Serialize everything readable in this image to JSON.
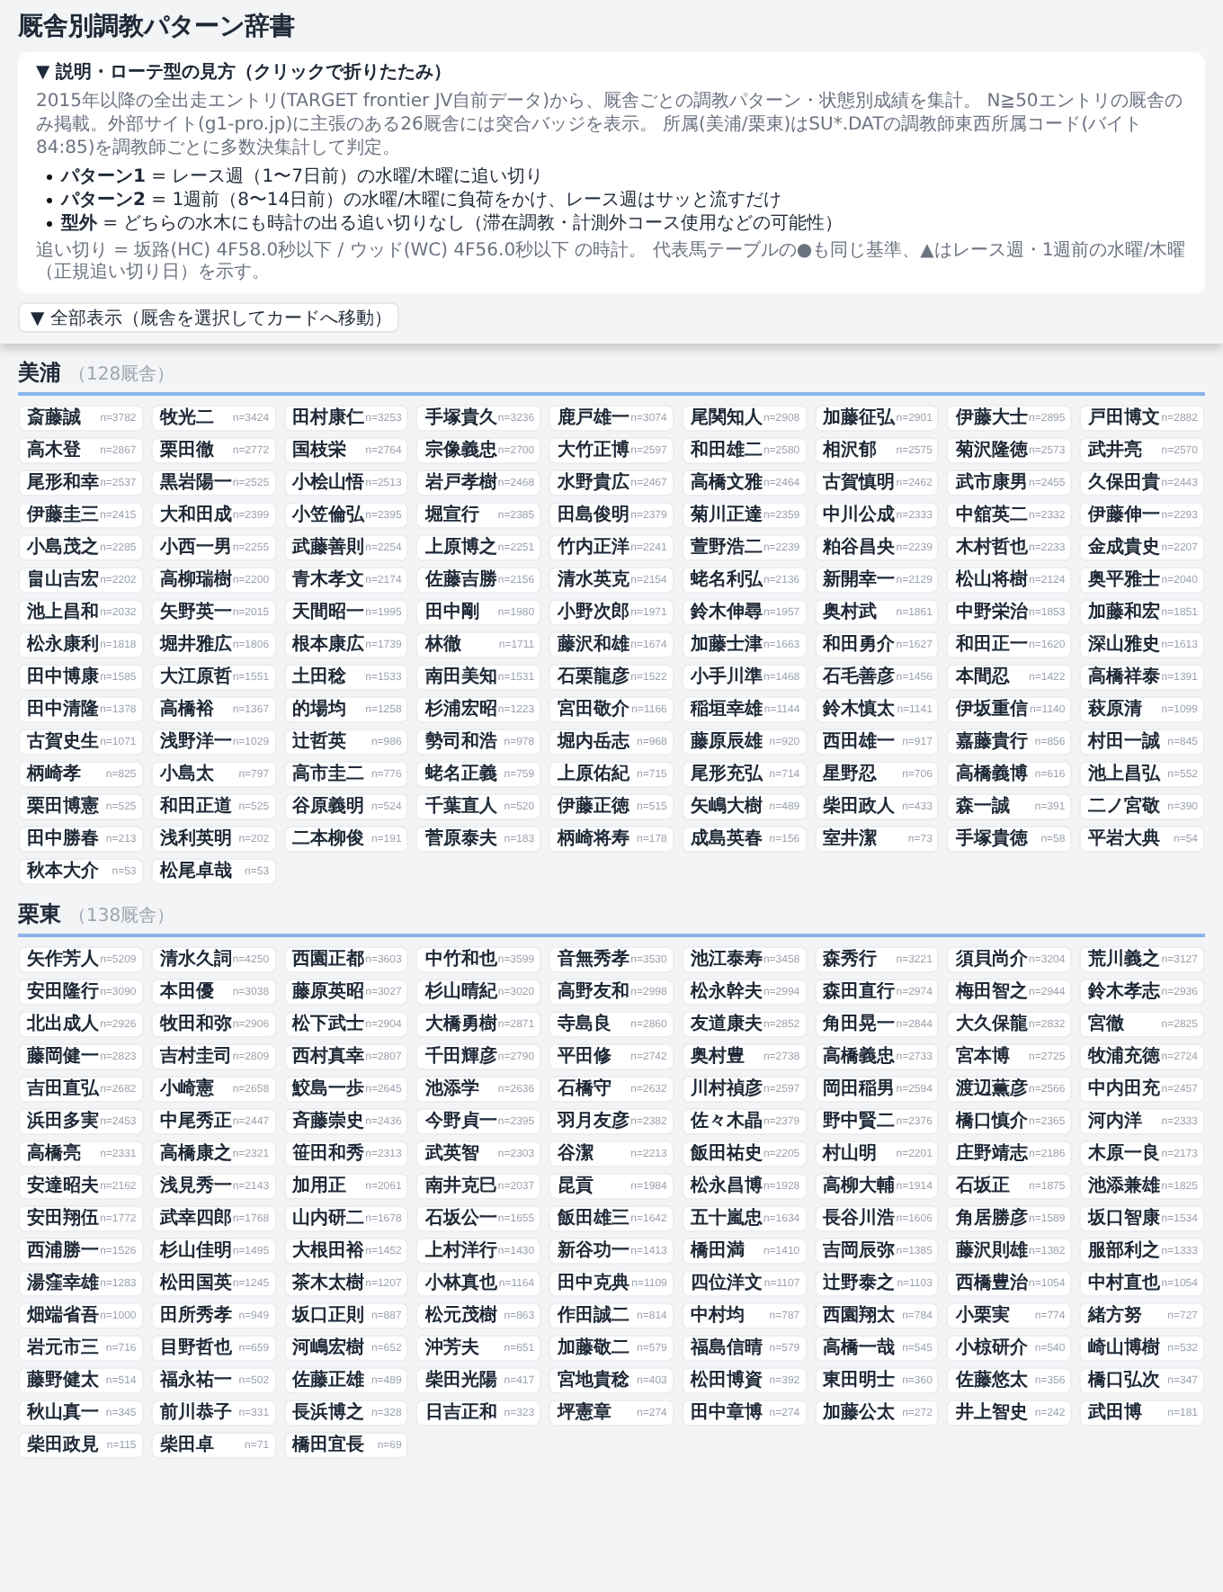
{
  "title": "厩舎別調教パターン辞書",
  "explanation": {
    "summary": "▼ 説明・ローテ型の見方（クリックで折りたたみ）",
    "paragraph": "2015年以降の全出走エントリ(TARGET frontier JV自前データ)から、厩舎ごとの調教パターン・状態別成績を集計。 N≧50エントリの厩舎のみ掲載。外部サイト(g1-pro.jp)に主張のある26厩舎には突合バッジを表示。 所属(美浦/栗東)はSU*.DATの調教師東西所属コード(バイト84:85)を調教師ごとに多数決集計して判定。",
    "bullets": [
      "**パターン1** = レース週（1〜7日前）の水曜/木曜に追い切り",
      "**パターン2** = 1週前（8〜14日前）の水曜/木曜に負荷をかけ、レース週はサッと流すだけ",
      "**型外** = どちらの水木にも時計の出る追い切りなし（滞在調教・計測外コース使用などの可能性）"
    ],
    "note": "追い切り = 坂路(HC) 4F58.0秒以下 / ウッド(WC) 4F56.0秒以下 の時計。 代表馬テーブルの●も同じ基準、▲はレース週・1週前の水曜/木曜（正規追い切り日）を示す。"
  },
  "jump_select": {
    "value": "▼ 全部表示（厩舎を選択してカードへ移動）"
  },
  "sections": [
    {
      "name": "美浦",
      "count": "（128厩舎）",
      "stables": [
        {
          "name": "斎藤誠",
          "n": "n=3782"
        },
        {
          "name": "牧光二",
          "n": "n=3424"
        },
        {
          "name": "田村康仁",
          "n": "n=3253"
        },
        {
          "name": "手塚貴久",
          "n": "n=3236"
        },
        {
          "name": "鹿戸雄一",
          "n": "n=3074"
        },
        {
          "name": "尾関知人",
          "n": "n=2908"
        },
        {
          "name": "加藤征弘",
          "n": "n=2901"
        },
        {
          "name": "伊藤大士",
          "n": "n=2895"
        },
        {
          "name": "戸田博文",
          "n": "n=2882"
        },
        {
          "name": "高木登",
          "n": "n=2867"
        },
        {
          "name": "栗田徹",
          "n": "n=2772"
        },
        {
          "name": "国枝栄",
          "n": "n=2764"
        },
        {
          "name": "宗像義忠",
          "n": "n=2700"
        },
        {
          "name": "大竹正博",
          "n": "n=2597"
        },
        {
          "name": "和田雄二",
          "n": "n=2580"
        },
        {
          "name": "相沢郁",
          "n": "n=2575"
        },
        {
          "name": "菊沢隆徳",
          "n": "n=2573"
        },
        {
          "name": "武井亮",
          "n": "n=2570"
        },
        {
          "name": "尾形和幸",
          "n": "n=2537"
        },
        {
          "name": "黒岩陽一",
          "n": "n=2525"
        },
        {
          "name": "小桧山悟",
          "n": "n=2513"
        },
        {
          "name": "岩戸孝樹",
          "n": "n=2468"
        },
        {
          "name": "水野貴広",
          "n": "n=2467"
        },
        {
          "name": "高橋文雅",
          "n": "n=2464"
        },
        {
          "name": "古賀慎明",
          "n": "n=2462"
        },
        {
          "name": "武市康男",
          "n": "n=2455"
        },
        {
          "name": "久保田貴",
          "n": "n=2443"
        },
        {
          "name": "伊藤圭三",
          "n": "n=2415"
        },
        {
          "name": "大和田成",
          "n": "n=2399"
        },
        {
          "name": "小笠倫弘",
          "n": "n=2395"
        },
        {
          "name": "堀宣行",
          "n": "n=2385"
        },
        {
          "name": "田島俊明",
          "n": "n=2379"
        },
        {
          "name": "菊川正達",
          "n": "n=2359"
        },
        {
          "name": "中川公成",
          "n": "n=2333"
        },
        {
          "name": "中舘英二",
          "n": "n=2332"
        },
        {
          "name": "伊藤伸一",
          "n": "n=2293"
        },
        {
          "name": "小島茂之",
          "n": "n=2285"
        },
        {
          "name": "小西一男",
          "n": "n=2255"
        },
        {
          "name": "武藤善則",
          "n": "n=2254"
        },
        {
          "name": "上原博之",
          "n": "n=2251"
        },
        {
          "name": "竹内正洋",
          "n": "n=2241"
        },
        {
          "name": "萱野浩二",
          "n": "n=2239"
        },
        {
          "name": "粕谷昌央",
          "n": "n=2239"
        },
        {
          "name": "木村哲也",
          "n": "n=2233"
        },
        {
          "name": "金成貴史",
          "n": "n=2207"
        },
        {
          "name": "畠山吉宏",
          "n": "n=2202"
        },
        {
          "name": "高柳瑞樹",
          "n": "n=2200"
        },
        {
          "name": "青木孝文",
          "n": "n=2174"
        },
        {
          "name": "佐藤吉勝",
          "n": "n=2156"
        },
        {
          "name": "清水英克",
          "n": "n=2154"
        },
        {
          "name": "蛯名利弘",
          "n": "n=2136"
        },
        {
          "name": "新開幸一",
          "n": "n=2129"
        },
        {
          "name": "松山将樹",
          "n": "n=2124"
        },
        {
          "name": "奥平雅士",
          "n": "n=2040"
        },
        {
          "name": "池上昌和",
          "n": "n=2032"
        },
        {
          "name": "矢野英一",
          "n": "n=2015"
        },
        {
          "name": "天間昭一",
          "n": "n=1995"
        },
        {
          "name": "田中剛",
          "n": "n=1980"
        },
        {
          "name": "小野次郎",
          "n": "n=1971"
        },
        {
          "name": "鈴木伸尋",
          "n": "n=1957"
        },
        {
          "name": "奥村武",
          "n": "n=1861"
        },
        {
          "name": "中野栄治",
          "n": "n=1853"
        },
        {
          "name": "加藤和宏",
          "n": "n=1851"
        },
        {
          "name": "松永康利",
          "n": "n=1818"
        },
        {
          "name": "堀井雅広",
          "n": "n=1806"
        },
        {
          "name": "根本康広",
          "n": "n=1739"
        },
        {
          "name": "林徹",
          "n": "n=1711"
        },
        {
          "name": "藤沢和雄",
          "n": "n=1674"
        },
        {
          "name": "加藤士津",
          "n": "n=1663"
        },
        {
          "name": "和田勇介",
          "n": "n=1627"
        },
        {
          "name": "和田正一",
          "n": "n=1620"
        },
        {
          "name": "深山雅史",
          "n": "n=1613"
        },
        {
          "name": "田中博康",
          "n": "n=1585"
        },
        {
          "name": "大江原哲",
          "n": "n=1551"
        },
        {
          "name": "土田稔",
          "n": "n=1533"
        },
        {
          "name": "南田美知",
          "n": "n=1531"
        },
        {
          "name": "石栗龍彦",
          "n": "n=1522"
        },
        {
          "name": "小手川準",
          "n": "n=1468"
        },
        {
          "name": "石毛善彦",
          "n": "n=1456"
        },
        {
          "name": "本間忍",
          "n": "n=1422"
        },
        {
          "name": "高橋祥泰",
          "n": "n=1391"
        },
        {
          "name": "田中清隆",
          "n": "n=1378"
        },
        {
          "name": "高橋裕",
          "n": "n=1367"
        },
        {
          "name": "的場均",
          "n": "n=1258"
        },
        {
          "name": "杉浦宏昭",
          "n": "n=1223"
        },
        {
          "name": "宮田敬介",
          "n": "n=1166"
        },
        {
          "name": "稲垣幸雄",
          "n": "n=1144"
        },
        {
          "name": "鈴木慎太",
          "n": "n=1141"
        },
        {
          "name": "伊坂重信",
          "n": "n=1140"
        },
        {
          "name": "萩原清",
          "n": "n=1099"
        },
        {
          "name": "古賀史生",
          "n": "n=1071"
        },
        {
          "name": "浅野洋一",
          "n": "n=1029"
        },
        {
          "name": "辻哲英",
          "n": "n=986"
        },
        {
          "name": "勢司和浩",
          "n": "n=978"
        },
        {
          "name": "堀内岳志",
          "n": "n=968"
        },
        {
          "name": "藤原辰雄",
          "n": "n=920"
        },
        {
          "name": "西田雄一",
          "n": "n=917"
        },
        {
          "name": "嘉藤貴行",
          "n": "n=856"
        },
        {
          "name": "村田一誠",
          "n": "n=845"
        },
        {
          "name": "柄崎孝",
          "n": "n=825"
        },
        {
          "name": "小島太",
          "n": "n=797"
        },
        {
          "name": "高市圭二",
          "n": "n=776"
        },
        {
          "name": "蛯名正義",
          "n": "n=759"
        },
        {
          "name": "上原佑紀",
          "n": "n=715"
        },
        {
          "name": "尾形充弘",
          "n": "n=714"
        },
        {
          "name": "星野忍",
          "n": "n=706"
        },
        {
          "name": "高橋義博",
          "n": "n=616"
        },
        {
          "name": "池上昌弘",
          "n": "n=552"
        },
        {
          "name": "栗田博憲",
          "n": "n=525"
        },
        {
          "name": "和田正道",
          "n": "n=525"
        },
        {
          "name": "谷原義明",
          "n": "n=524"
        },
        {
          "name": "千葉直人",
          "n": "n=520"
        },
        {
          "name": "伊藤正徳",
          "n": "n=515"
        },
        {
          "name": "矢嶋大樹",
          "n": "n=489"
        },
        {
          "name": "柴田政人",
          "n": "n=433"
        },
        {
          "name": "森一誠",
          "n": "n=391"
        },
        {
          "name": "二ノ宮敬",
          "n": "n=390"
        },
        {
          "name": "田中勝春",
          "n": "n=213"
        },
        {
          "name": "浅利英明",
          "n": "n=202"
        },
        {
          "name": "二本柳俊",
          "n": "n=191"
        },
        {
          "name": "菅原泰夫",
          "n": "n=183"
        },
        {
          "name": "柄崎将寿",
          "n": "n=178"
        },
        {
          "name": "成島英春",
          "n": "n=156"
        },
        {
          "name": "室井潔",
          "n": "n=73"
        },
        {
          "name": "手塚貴徳",
          "n": "n=58"
        },
        {
          "name": "平岩大典",
          "n": "n=54"
        },
        {
          "name": "秋本大介",
          "n": "n=53"
        },
        {
          "name": "松尾卓哉",
          "n": "n=53"
        }
      ]
    },
    {
      "name": "栗東",
      "count": "（138厩舎）",
      "stables": [
        {
          "name": "矢作芳人",
          "n": "n=5209"
        },
        {
          "name": "清水久詞",
          "n": "n=4250"
        },
        {
          "name": "西園正都",
          "n": "n=3603"
        },
        {
          "name": "中竹和也",
          "n": "n=3599"
        },
        {
          "name": "音無秀孝",
          "n": "n=3530"
        },
        {
          "name": "池江泰寿",
          "n": "n=3458"
        },
        {
          "name": "森秀行",
          "n": "n=3221"
        },
        {
          "name": "須貝尚介",
          "n": "n=3204"
        },
        {
          "name": "荒川義之",
          "n": "n=3127"
        },
        {
          "name": "安田隆行",
          "n": "n=3090"
        },
        {
          "name": "本田優",
          "n": "n=3038"
        },
        {
          "name": "藤原英昭",
          "n": "n=3027"
        },
        {
          "name": "杉山晴紀",
          "n": "n=3020"
        },
        {
          "name": "高野友和",
          "n": "n=2998"
        },
        {
          "name": "松永幹夫",
          "n": "n=2994"
        },
        {
          "name": "森田直行",
          "n": "n=2974"
        },
        {
          "name": "梅田智之",
          "n": "n=2944"
        },
        {
          "name": "鈴木孝志",
          "n": "n=2936"
        },
        {
          "name": "北出成人",
          "n": "n=2926"
        },
        {
          "name": "牧田和弥",
          "n": "n=2906"
        },
        {
          "name": "松下武士",
          "n": "n=2904"
        },
        {
          "name": "大橋勇樹",
          "n": "n=2871"
        },
        {
          "name": "寺島良",
          "n": "n=2860"
        },
        {
          "name": "友道康夫",
          "n": "n=2852"
        },
        {
          "name": "角田晃一",
          "n": "n=2844"
        },
        {
          "name": "大久保龍",
          "n": "n=2832"
        },
        {
          "name": "宮徹",
          "n": "n=2825"
        },
        {
          "name": "藤岡健一",
          "n": "n=2823"
        },
        {
          "name": "吉村圭司",
          "n": "n=2809"
        },
        {
          "name": "西村真幸",
          "n": "n=2807"
        },
        {
          "name": "千田輝彦",
          "n": "n=2790"
        },
        {
          "name": "平田修",
          "n": "n=2742"
        },
        {
          "name": "奥村豊",
          "n": "n=2738"
        },
        {
          "name": "高橋義忠",
          "n": "n=2733"
        },
        {
          "name": "宮本博",
          "n": "n=2725"
        },
        {
          "name": "牧浦充徳",
          "n": "n=2724"
        },
        {
          "name": "吉田直弘",
          "n": "n=2682"
        },
        {
          "name": "小崎憲",
          "n": "n=2658"
        },
        {
          "name": "鮫島一歩",
          "n": "n=2645"
        },
        {
          "name": "池添学",
          "n": "n=2636"
        },
        {
          "name": "石橋守",
          "n": "n=2632"
        },
        {
          "name": "川村禎彦",
          "n": "n=2597"
        },
        {
          "name": "岡田稲男",
          "n": "n=2594"
        },
        {
          "name": "渡辺薫彦",
          "n": "n=2566"
        },
        {
          "name": "中内田充",
          "n": "n=2457"
        },
        {
          "name": "浜田多実",
          "n": "n=2453"
        },
        {
          "name": "中尾秀正",
          "n": "n=2447"
        },
        {
          "name": "斉藤崇史",
          "n": "n=2436"
        },
        {
          "name": "今野貞一",
          "n": "n=2395"
        },
        {
          "name": "羽月友彦",
          "n": "n=2382"
        },
        {
          "name": "佐々木晶",
          "n": "n=2379"
        },
        {
          "name": "野中賢二",
          "n": "n=2376"
        },
        {
          "name": "橋口慎介",
          "n": "n=2365"
        },
        {
          "name": "河内洋",
          "n": "n=2333"
        },
        {
          "name": "高橋亮",
          "n": "n=2331"
        },
        {
          "name": "高橋康之",
          "n": "n=2321"
        },
        {
          "name": "笹田和秀",
          "n": "n=2313"
        },
        {
          "name": "武英智",
          "n": "n=2303"
        },
        {
          "name": "谷潔",
          "n": "n=2213"
        },
        {
          "name": "飯田祐史",
          "n": "n=2205"
        },
        {
          "name": "村山明",
          "n": "n=2201"
        },
        {
          "name": "庄野靖志",
          "n": "n=2186"
        },
        {
          "name": "木原一良",
          "n": "n=2173"
        },
        {
          "name": "安達昭夫",
          "n": "n=2162"
        },
        {
          "name": "浅見秀一",
          "n": "n=2143"
        },
        {
          "name": "加用正",
          "n": "n=2061"
        },
        {
          "name": "南井克巳",
          "n": "n=2037"
        },
        {
          "name": "昆貢",
          "n": "n=1984"
        },
        {
          "name": "松永昌博",
          "n": "n=1928"
        },
        {
          "name": "高柳大輔",
          "n": "n=1914"
        },
        {
          "name": "石坂正",
          "n": "n=1875"
        },
        {
          "name": "池添兼雄",
          "n": "n=1825"
        },
        {
          "name": "安田翔伍",
          "n": "n=1772"
        },
        {
          "name": "武幸四郎",
          "n": "n=1768"
        },
        {
          "name": "山内研二",
          "n": "n=1678"
        },
        {
          "name": "石坂公一",
          "n": "n=1655"
        },
        {
          "name": "飯田雄三",
          "n": "n=1642"
        },
        {
          "name": "五十嵐忠",
          "n": "n=1634"
        },
        {
          "name": "長谷川浩",
          "n": "n=1606"
        },
        {
          "name": "角居勝彦",
          "n": "n=1589"
        },
        {
          "name": "坂口智康",
          "n": "n=1534"
        },
        {
          "name": "西浦勝一",
          "n": "n=1526"
        },
        {
          "name": "杉山佳明",
          "n": "n=1495"
        },
        {
          "name": "大根田裕",
          "n": "n=1452"
        },
        {
          "name": "上村洋行",
          "n": "n=1430"
        },
        {
          "name": "新谷功一",
          "n": "n=1413"
        },
        {
          "name": "橋田満",
          "n": "n=1410"
        },
        {
          "name": "吉岡辰弥",
          "n": "n=1385"
        },
        {
          "name": "藤沢則雄",
          "n": "n=1382"
        },
        {
          "name": "服部利之",
          "n": "n=1333"
        },
        {
          "name": "湯窪幸雄",
          "n": "n=1283"
        },
        {
          "name": "松田国英",
          "n": "n=1245"
        },
        {
          "name": "茶木太樹",
          "n": "n=1207"
        },
        {
          "name": "小林真也",
          "n": "n=1164"
        },
        {
          "name": "田中克典",
          "n": "n=1109"
        },
        {
          "name": "四位洋文",
          "n": "n=1107"
        },
        {
          "name": "辻野泰之",
          "n": "n=1103"
        },
        {
          "name": "西橋豊治",
          "n": "n=1054"
        },
        {
          "name": "中村直也",
          "n": "n=1054"
        },
        {
          "name": "畑端省吾",
          "n": "n=1000"
        },
        {
          "name": "田所秀孝",
          "n": "n=949"
        },
        {
          "name": "坂口正則",
          "n": "n=887"
        },
        {
          "name": "松元茂樹",
          "n": "n=863"
        },
        {
          "name": "作田誠二",
          "n": "n=814"
        },
        {
          "name": "中村均",
          "n": "n=787"
        },
        {
          "name": "西園翔太",
          "n": "n=784"
        },
        {
          "name": "小栗実",
          "n": "n=774"
        },
        {
          "name": "緒方努",
          "n": "n=727"
        },
        {
          "name": "岩元市三",
          "n": "n=716"
        },
        {
          "name": "目野哲也",
          "n": "n=659"
        },
        {
          "name": "河嶋宏樹",
          "n": "n=652"
        },
        {
          "name": "沖芳夫",
          "n": "n=651"
        },
        {
          "name": "加藤敬二",
          "n": "n=579"
        },
        {
          "name": "福島信晴",
          "n": "n=579"
        },
        {
          "name": "高橋一哉",
          "n": "n=545"
        },
        {
          "name": "小椋研介",
          "n": "n=540"
        },
        {
          "name": "崎山博樹",
          "n": "n=532"
        },
        {
          "name": "藤野健太",
          "n": "n=514"
        },
        {
          "name": "福永祐一",
          "n": "n=502"
        },
        {
          "name": "佐藤正雄",
          "n": "n=489"
        },
        {
          "name": "柴田光陽",
          "n": "n=417"
        },
        {
          "name": "宮地貴稔",
          "n": "n=403"
        },
        {
          "name": "松田博資",
          "n": "n=392"
        },
        {
          "name": "東田明士",
          "n": "n=360"
        },
        {
          "name": "佐藤悠太",
          "n": "n=356"
        },
        {
          "name": "橋口弘次",
          "n": "n=347"
        },
        {
          "name": "秋山真一",
          "n": "n=345"
        },
        {
          "name": "前川恭子",
          "n": "n=331"
        },
        {
          "name": "長浜博之",
          "n": "n=328"
        },
        {
          "name": "日吉正和",
          "n": "n=323"
        },
        {
          "name": "坪憲章",
          "n": "n=274"
        },
        {
          "name": "田中章博",
          "n": "n=274"
        },
        {
          "name": "加藤公太",
          "n": "n=272"
        },
        {
          "name": "井上智史",
          "n": "n=242"
        },
        {
          "name": "武田博",
          "n": "n=181"
        },
        {
          "name": "柴田政見",
          "n": "n=115"
        },
        {
          "name": "柴田卓",
          "n": "n=71"
        },
        {
          "name": "橋田宜長",
          "n": "n=69"
        }
      ]
    }
  ]
}
